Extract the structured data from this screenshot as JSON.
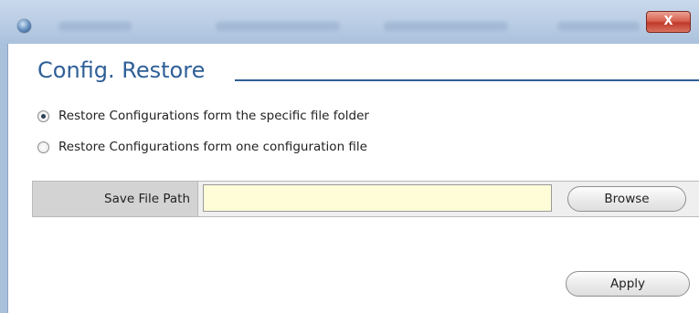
{
  "window": {
    "title_blurred": "Camera-1   00:0F:7C:1A:D3:47   AXIS-990-4C3C2D-4C   Megapixel IP ...",
    "close_label": "X"
  },
  "page": {
    "title": "Config. Restore"
  },
  "options": [
    {
      "label": "Restore Configurations form the specific file folder",
      "selected": true
    },
    {
      "label": "Restore Configurations form one configuration file",
      "selected": false
    }
  ],
  "path_field": {
    "label": "Save File Path",
    "value": "",
    "background": "#fffdd8"
  },
  "buttons": {
    "browse": "Browse",
    "apply": "Apply"
  },
  "colors": {
    "heading": "#2f5f97",
    "close_button": "#d86150"
  }
}
